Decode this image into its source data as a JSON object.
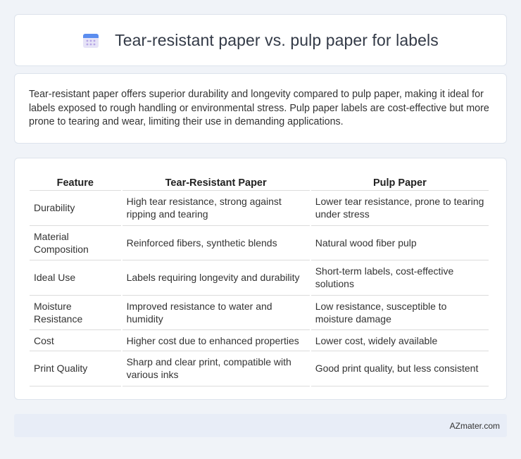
{
  "header": {
    "title": "Tear-resistant paper vs. pulp paper for labels",
    "icon": "calendar-icon",
    "icon_colors": {
      "top": "#5b8def",
      "body": "#e6e3f7",
      "dots": "#b6a5e6"
    }
  },
  "summary": {
    "text": "Tear-resistant paper offers superior durability and longevity compared to pulp paper, making it ideal for labels exposed to rough handling or environmental stress. Pulp paper labels are cost-effective but more prone to tearing and wear, limiting their use in demanding applications."
  },
  "table": {
    "headers": [
      "Feature",
      "Tear-Resistant Paper",
      "Pulp Paper"
    ],
    "rows": [
      {
        "feature": "Durability",
        "tear": "High tear resistance, strong against ripping and tearing",
        "pulp": "Lower tear resistance, prone to tearing under stress"
      },
      {
        "feature": "Material Composition",
        "tear": "Reinforced fibers, synthetic blends",
        "pulp": "Natural wood fiber pulp"
      },
      {
        "feature": "Ideal Use",
        "tear": "Labels requiring longevity and durability",
        "pulp": "Short-term labels, cost-effective solutions"
      },
      {
        "feature": "Moisture Resistance",
        "tear": "Improved resistance to water and humidity",
        "pulp": "Low resistance, susceptible to moisture damage"
      },
      {
        "feature": "Cost",
        "tear": "Higher cost due to enhanced properties",
        "pulp": "Lower cost, widely available"
      },
      {
        "feature": "Print Quality",
        "tear": "Sharp and clear print, compatible with various inks",
        "pulp": "Good print quality, but less consistent"
      }
    ]
  },
  "footer": {
    "text": "AZmater.com"
  }
}
